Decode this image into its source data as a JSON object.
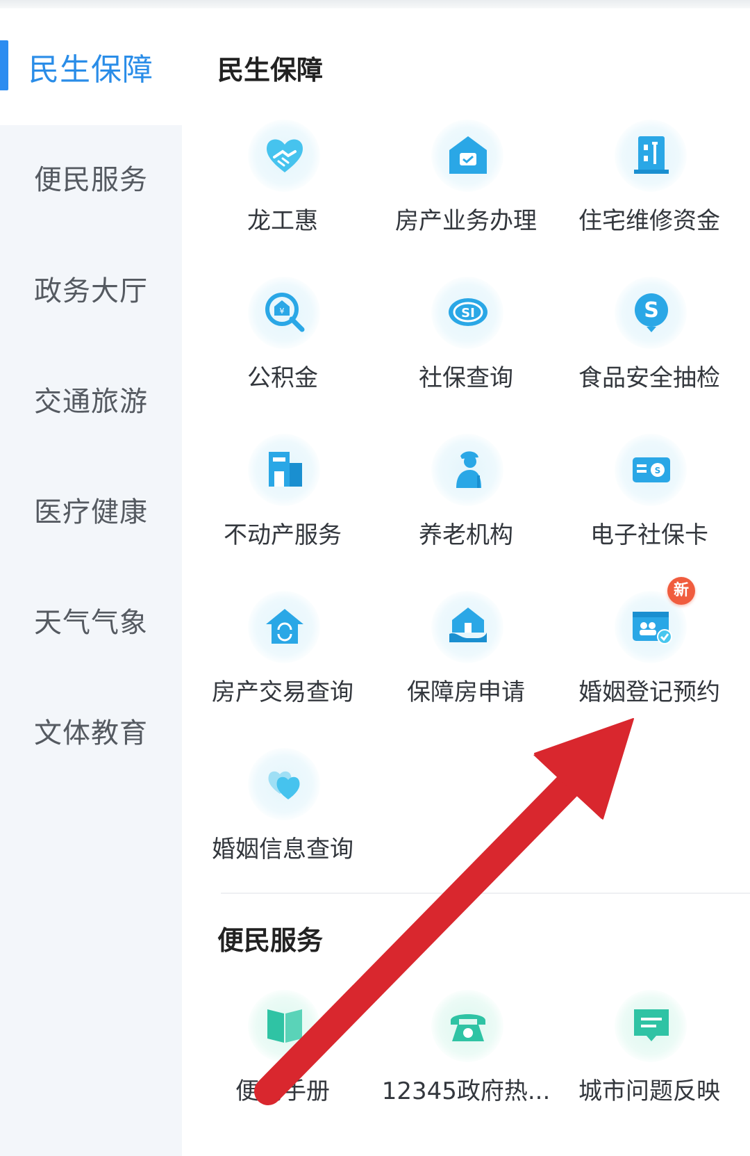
{
  "sidebar": {
    "items": [
      {
        "label": "民生保障",
        "active": true
      },
      {
        "label": "便民服务"
      },
      {
        "label": "政务大厅"
      },
      {
        "label": "交通旅游"
      },
      {
        "label": "医疗健康"
      },
      {
        "label": "天气气象"
      },
      {
        "label": "文体教育"
      }
    ]
  },
  "sections": [
    {
      "title": "民生保障",
      "items": [
        {
          "label": "龙工惠",
          "icon": "handshake-heart-icon"
        },
        {
          "label": "房产业务办理",
          "icon": "house-id-icon"
        },
        {
          "label": "住宅维修资金",
          "icon": "building-tools-icon"
        },
        {
          "label": "公积金",
          "icon": "search-yuan-house-icon"
        },
        {
          "label": "社保查询",
          "icon": "si-logo-icon"
        },
        {
          "label": "食品安全抽检",
          "icon": "s-search-icon"
        },
        {
          "label": "不动产服务",
          "icon": "building-icon"
        },
        {
          "label": "养老机构",
          "icon": "elderly-person-icon"
        },
        {
          "label": "电子社保卡",
          "icon": "social-security-card-icon"
        },
        {
          "label": "房产交易查询",
          "icon": "house-exchange-icon"
        },
        {
          "label": "保障房申请",
          "icon": "house-in-hand-icon"
        },
        {
          "label": "婚姻登记预约",
          "icon": "marriage-certificate-icon",
          "badge": "新"
        },
        {
          "label": "婚姻信息查询",
          "icon": "hearts-icon"
        }
      ]
    },
    {
      "title": "便民服务",
      "items": [
        {
          "label": "便民手册",
          "icon": "book-icon"
        },
        {
          "label": "12345政府热...",
          "icon": "telephone-icon"
        },
        {
          "label": "城市问题反映",
          "icon": "message-icon"
        }
      ]
    }
  ],
  "colors": {
    "accent": "#2a8de8",
    "icon_blue": "#2aa7e6",
    "icon_green": "#2fc3a4",
    "badge": "#f05c3e",
    "arrow": "#d9272e"
  }
}
